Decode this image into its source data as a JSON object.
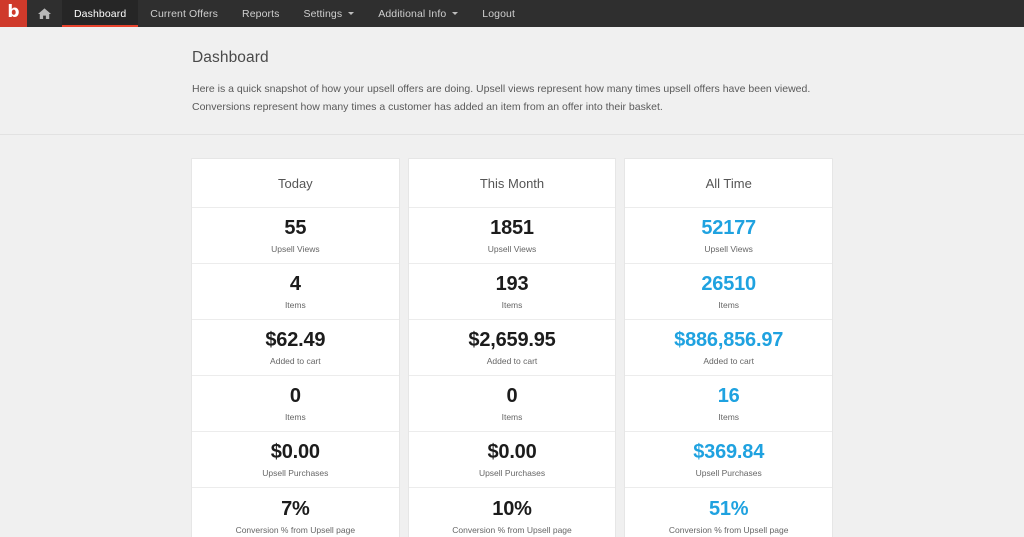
{
  "navbar": {
    "brand_letter": "b",
    "brand_color": "#cf3a2b",
    "home_icon": "home-icon",
    "active_underline_color": "#e8432d",
    "items": [
      {
        "label": "Dashboard",
        "active": true,
        "caret": false
      },
      {
        "label": "Current Offers",
        "active": false,
        "caret": false
      },
      {
        "label": "Reports",
        "active": false,
        "caret": false
      },
      {
        "label": "Settings",
        "active": false,
        "caret": true
      },
      {
        "label": "Additional Info",
        "active": false,
        "caret": true
      },
      {
        "label": "Logout",
        "active": false,
        "caret": false
      }
    ]
  },
  "header": {
    "title": "Dashboard",
    "description": "Here is a quick snapshot of how your upsell offers are doing. Upsell views represent how many times upsell offers have been viewed. Conversions represent how many times a customer has added an item from an offer into their basket."
  },
  "accent_color": "#1fa2e0",
  "cards": [
    {
      "title": "Today",
      "accent": false,
      "stats": [
        {
          "value": "55",
          "label": "Upsell Views"
        },
        {
          "value": "4",
          "label": "Items"
        },
        {
          "value": "$62.49",
          "label": "Added to cart"
        },
        {
          "value": "0",
          "label": "Items"
        },
        {
          "value": "$0.00",
          "label": "Upsell Purchases"
        },
        {
          "value": "7%",
          "label": "Conversion % from Upsell page"
        }
      ]
    },
    {
      "title": "This Month",
      "accent": false,
      "stats": [
        {
          "value": "1851",
          "label": "Upsell Views"
        },
        {
          "value": "193",
          "label": "Items"
        },
        {
          "value": "$2,659.95",
          "label": "Added to cart"
        },
        {
          "value": "0",
          "label": "Items"
        },
        {
          "value": "$0.00",
          "label": "Upsell Purchases"
        },
        {
          "value": "10%",
          "label": "Conversion % from Upsell page"
        }
      ]
    },
    {
      "title": "All Time",
      "accent": true,
      "stats": [
        {
          "value": "52177",
          "label": "Upsell Views"
        },
        {
          "value": "26510",
          "label": "Items"
        },
        {
          "value": "$886,856.97",
          "label": "Added to cart"
        },
        {
          "value": "16",
          "label": "Items"
        },
        {
          "value": "$369.84",
          "label": "Upsell Purchases"
        },
        {
          "value": "51%",
          "label": "Conversion % from Upsell page"
        }
      ]
    }
  ]
}
